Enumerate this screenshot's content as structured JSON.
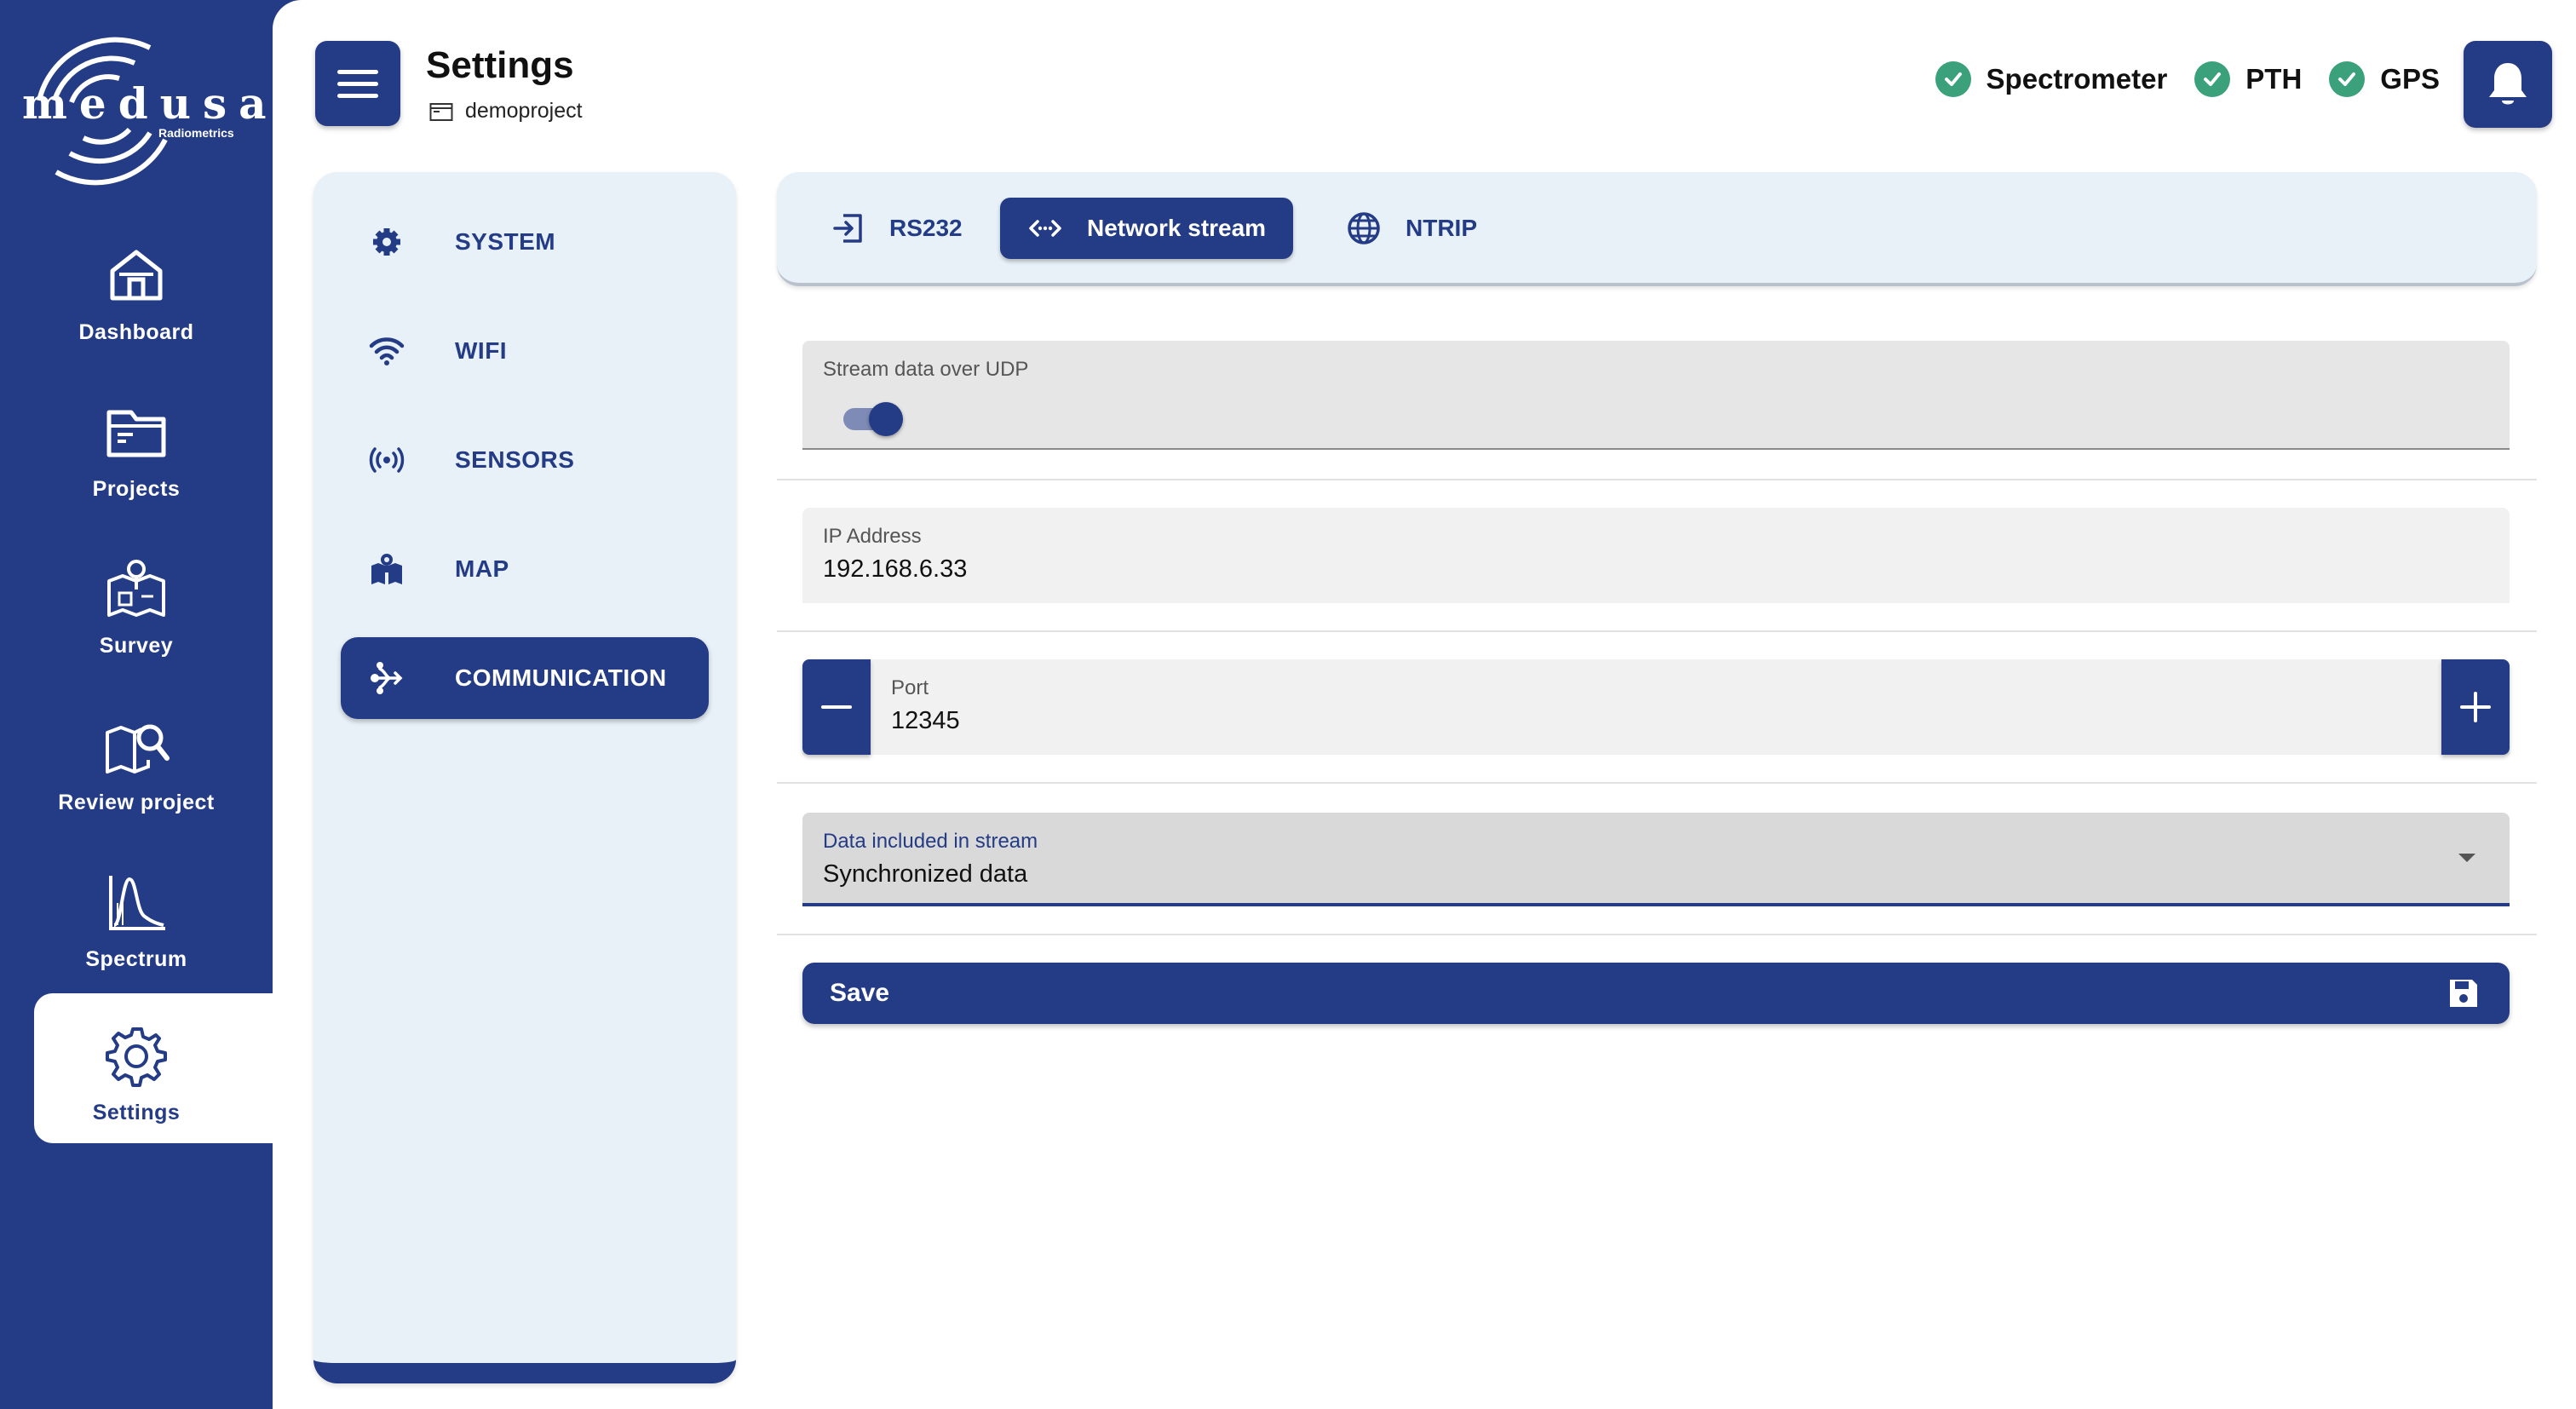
{
  "app": {
    "brand_name": "medusa",
    "brand_sub": "Radiometrics"
  },
  "nav": {
    "items": [
      {
        "label": "Dashboard",
        "icon": "home-icon"
      },
      {
        "label": "Projects",
        "icon": "folder-icon"
      },
      {
        "label": "Survey",
        "icon": "survey-map-icon"
      },
      {
        "label": "Review project",
        "icon": "map-search-icon"
      },
      {
        "label": "Spectrum",
        "icon": "spectrum-chart-icon"
      },
      {
        "label": "Settings",
        "icon": "gear-icon",
        "active": true
      }
    ]
  },
  "header": {
    "title": "Settings",
    "project": "demoproject"
  },
  "status": [
    {
      "label": "Spectrometer",
      "state": "ok"
    },
    {
      "label": "PTH",
      "state": "ok"
    },
    {
      "label": "GPS",
      "state": "ok"
    }
  ],
  "categories": [
    {
      "label": "SYSTEM",
      "icon": "gear-icon"
    },
    {
      "label": "WIFI",
      "icon": "wifi-icon"
    },
    {
      "label": "SENSORS",
      "icon": "sensor-icon"
    },
    {
      "label": "MAP",
      "icon": "map-pin-icon"
    },
    {
      "label": "COMMUNICATION",
      "icon": "communication-icon",
      "active": true
    }
  ],
  "tabs": [
    {
      "label": "RS232",
      "icon": "login-arrow-icon"
    },
    {
      "label": "Network stream",
      "icon": "code-dots-icon",
      "active": true
    },
    {
      "label": "NTRIP",
      "icon": "globe-icon"
    }
  ],
  "form": {
    "udp": {
      "label": "Stream data over UDP",
      "enabled": true
    },
    "ip": {
      "label": "IP Address",
      "value": "192.168.6.33"
    },
    "port": {
      "label": "Port",
      "value": "12345"
    },
    "data": {
      "label": "Data included in stream",
      "value": "Synchronized data"
    },
    "save_label": "Save"
  },
  "colors": {
    "primary": "#243b85",
    "panel": "#e8f1f8",
    "status_ok": "#3aa17a"
  }
}
